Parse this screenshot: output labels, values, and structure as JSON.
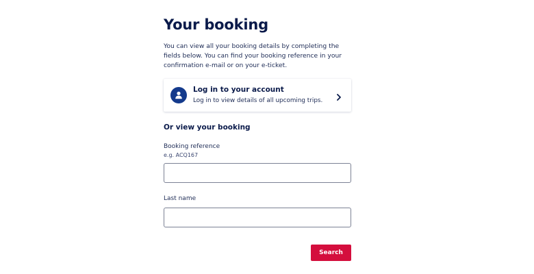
{
  "page": {
    "title": "Your booking",
    "intro": "You can view all your booking details by completing the fields below. You can find your booking reference in your confirmation e-mail or on your e-ticket."
  },
  "login_card": {
    "title": "Log in to your account",
    "subtitle": "Log in to view details of all upcoming trips.",
    "icon": "user-icon",
    "chevron_icon": "chevron-right-icon"
  },
  "form": {
    "heading": "Or view your booking",
    "booking_reference": {
      "label": "Booking reference",
      "hint": "e.g. ACQ167",
      "value": ""
    },
    "last_name": {
      "label": "Last name",
      "value": ""
    },
    "submit_label": "Search"
  },
  "colors": {
    "primary_text": "#0a1a4a",
    "accent_blue": "#143a8c",
    "button_red": "#d40e3d",
    "input_border": "#7b8194"
  }
}
